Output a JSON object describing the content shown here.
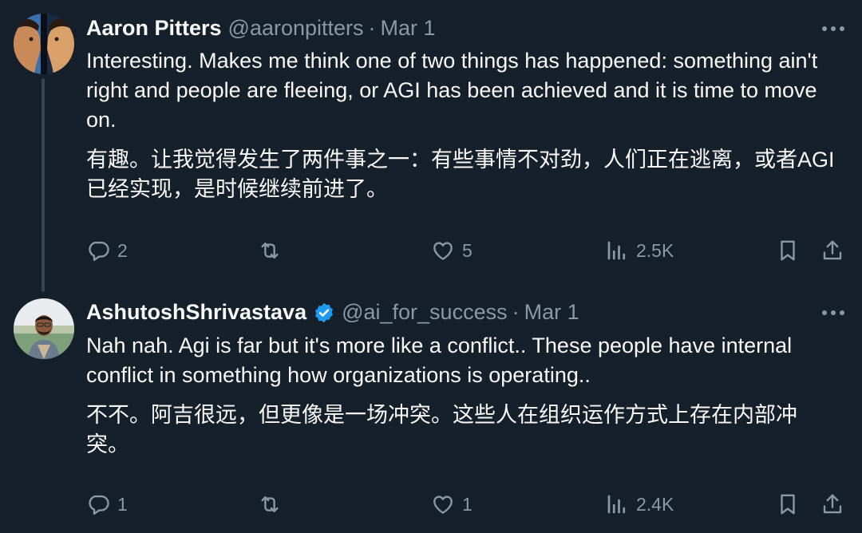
{
  "tweets": [
    {
      "author_name": "Aaron Pitters",
      "handle": "@aaronpitters",
      "separator": "·",
      "date": "Mar 1",
      "verified": false,
      "text_en": "Interesting. Makes me think one of two things has happened: something ain't right and people are fleeing, or AGI has been achieved and it is time to move on.",
      "text_zh": "有趣。让我觉得发生了两件事之一：有些事情不对劲，人们正在逃离，或者AGI已经实现，是时候继续前进了。",
      "replies": "2",
      "reposts": "",
      "likes": "5",
      "views": "2.5K"
    },
    {
      "author_name": "AshutoshShrivastava",
      "handle": "@ai_for_success",
      "separator": "·",
      "date": "Mar 1",
      "verified": true,
      "text_en": "Nah nah. Agi is far but it's more like a conflict.. These people have internal conflict in something how organizations is operating..",
      "text_zh": "不不。阿吉很远，但更像是一场冲突。这些人在组织运作方式上存在内部冲突。",
      "replies": "1",
      "reposts": "",
      "likes": "1",
      "views": "2.4K"
    }
  ],
  "icons": {
    "reply": "reply-icon",
    "repost": "repost-icon",
    "like": "like-icon",
    "views": "views-icon",
    "bookmark": "bookmark-icon",
    "share": "share-icon",
    "more": "more-icon",
    "verified": "verified-badge-icon"
  },
  "colors": {
    "background": "#15202b",
    "primary_text": "#f7f9f9",
    "secondary_text": "#8b98a5",
    "verified_blue": "#1d9bf0",
    "thread_line": "#38444d"
  }
}
